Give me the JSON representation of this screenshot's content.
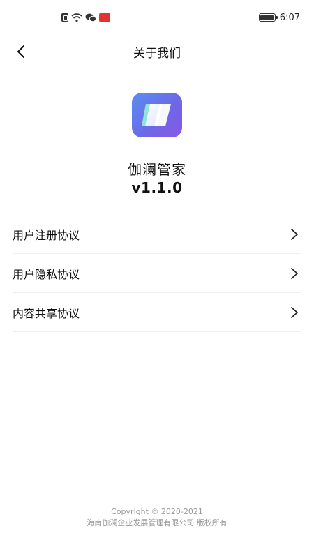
{
  "status_bar": {
    "time": "6:07",
    "icons": [
      "sim-card-icon",
      "wifi-icon",
      "wechat-icon",
      "app-notification-icon",
      "battery-icon"
    ]
  },
  "nav": {
    "back_icon": "chevron-left-icon",
    "title": "关于我们"
  },
  "app": {
    "logo_icon": "app-logo-icon",
    "name": "伽澜管家",
    "version": "v1.1.0"
  },
  "menu": {
    "items": [
      {
        "label": "用户注册协议",
        "icon": "chevron-right-icon"
      },
      {
        "label": "用户隐私协议",
        "icon": "chevron-right-icon"
      },
      {
        "label": "内容共享协议",
        "icon": "chevron-right-icon"
      }
    ]
  },
  "footer": {
    "copyright": "Copyright © 2020-2021",
    "company": "海南伽澜企业发展管理有限公司 版权所有"
  },
  "colors": {
    "logo_gradient_start": "#5a8ef2",
    "logo_gradient_end": "#8a56e6",
    "footer_text": "#9a9a9a",
    "divider": "#efefef"
  }
}
